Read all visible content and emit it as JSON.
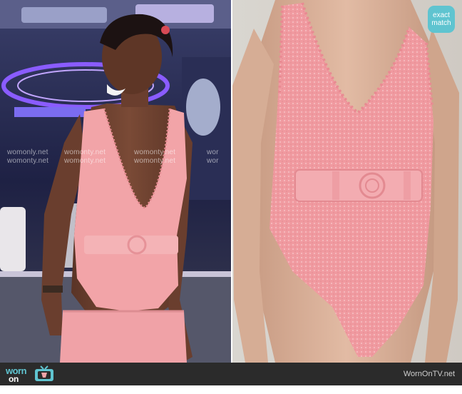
{
  "watermarks": {
    "left_1": "womonly.net",
    "left_2": "womonty.net",
    "left_3": "womonty.net",
    "left_4": "wor",
    "left_5": "womonty.net",
    "left_6": "womonty.net",
    "left_7": "womonty.net",
    "left_8": "wor"
  },
  "badge": {
    "line1": "exact",
    "line2": "match"
  },
  "footer": {
    "logo_top": "worn",
    "logo_bottom": "on tv",
    "site": "WornOnTV.net"
  },
  "colors": {
    "swimsuit": "#f2a4a8",
    "brand_teal": "#5fc4d0",
    "footer_bg": "#2b2b2b"
  },
  "icons": [
    "tv-icon"
  ]
}
